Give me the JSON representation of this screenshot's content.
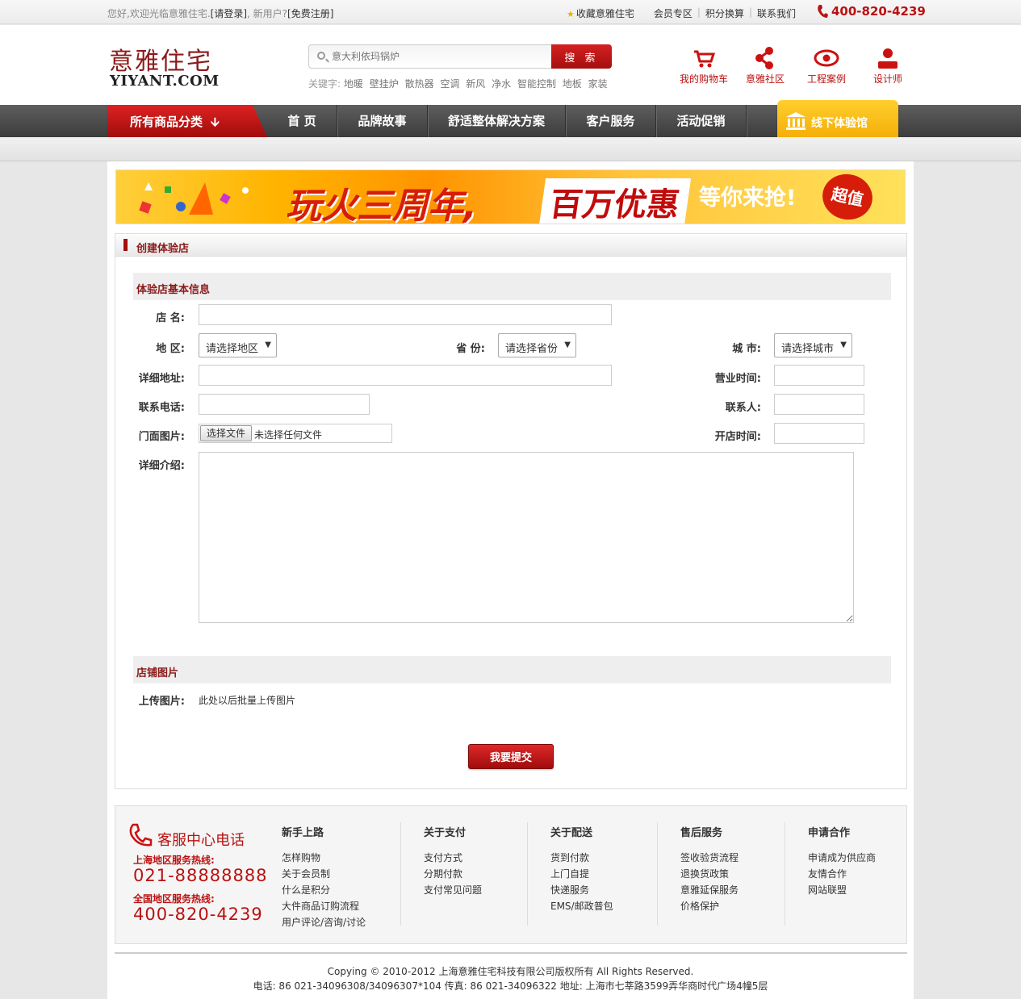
{
  "topbar": {
    "welcome": "您好,欢迎光临意雅住宅.",
    "login": "[请登录]",
    "new_user": ", 新用户?",
    "register": "[免费注册]",
    "bookmark": "收藏意雅住宅",
    "member": "会员专区",
    "points": "积分换算",
    "contact": "联系我们",
    "hotline": "400-820-4239"
  },
  "header": {
    "logo_cn": "意雅住宅",
    "logo_en": "YIYANT.COM",
    "search_placeholder": "意大利依玛锅炉",
    "search_button": "搜 索",
    "keywords_label": "关键字:",
    "keywords": [
      "地暖",
      "壁挂炉",
      "散热器",
      "空调",
      "新风",
      "净水",
      "智能控制",
      "地板",
      "家装"
    ],
    "icons": [
      {
        "label": "我的购物车",
        "icon": "cart-icon"
      },
      {
        "label": "意雅社区",
        "icon": "share-icon"
      },
      {
        "label": "工程案例",
        "icon": "eye-icon"
      },
      {
        "label": "设计师",
        "icon": "user-icon"
      }
    ]
  },
  "nav": {
    "category_button": "所有商品分类",
    "items": [
      {
        "label": "首 页"
      },
      {
        "label": "品牌故事"
      },
      {
        "label": "舒适整体解决方案"
      },
      {
        "label": "客户服务"
      },
      {
        "label": "活动促销"
      }
    ],
    "offline": "线下体验馆"
  },
  "banner": {
    "text1": "玩火三周年,",
    "text2": "百万优惠",
    "text3": "等你来抢!",
    "badge": "超值"
  },
  "form": {
    "panel_title": "创建体验店",
    "section_basic": "体验店基本信息",
    "store_name_label": "店 名:",
    "region_label": "地 区:",
    "region_select": "请选择地区",
    "province_label": "省 份:",
    "province_select": "请选择省份",
    "city_label": "城 市:",
    "city_select": "请选择城市",
    "address_label": "详细地址:",
    "hours_label": "营业时间:",
    "phone_label": "联系电话:",
    "contact_label": "联系人:",
    "photo_label": "门面图片:",
    "file_button": "选择文件",
    "file_text": "未选择任何文件",
    "open_date_label": "开店时间:",
    "intro_label": "详细介绍:",
    "section_photos": "店铺图片",
    "upload_label": "上传图片:",
    "upload_note": "此处以后批量上传图片",
    "submit": "我要提交"
  },
  "footer": {
    "service_title": "客服中心电话",
    "sh_label": "上海地区服务热线:",
    "sh_number": "021-88888888",
    "cn_label": "全国地区服务热线:",
    "cn_number": "400-820-4239",
    "columns": [
      {
        "title": "新手上路",
        "links": [
          "怎样购物",
          "关于会员制",
          "什么是积分",
          "大件商品订购流程",
          "用户评论/咨询/讨论"
        ]
      },
      {
        "title": "关于支付",
        "links": [
          "支付方式",
          "分期付款",
          "支付常见问题"
        ]
      },
      {
        "title": "关于配送",
        "links": [
          "货到付款",
          "上门自提",
          "快递服务",
          "EMS/邮政普包"
        ]
      },
      {
        "title": "售后服务",
        "links": [
          "签收验货流程",
          "退换货政策",
          "意雅延保服务",
          "价格保护"
        ]
      },
      {
        "title": "申请合作",
        "links": [
          "申请成为供应商",
          "友情合作",
          "网站联盟"
        ]
      }
    ],
    "copyright": "Copying © 2010-2012 上海意雅住宅科技有限公司版权所有 All Rights Reserved.",
    "contact_line": "电话: 86 021-34096308/34096307*104 传真: 86 021-34096322 地址: 上海市七莘路3599弄华商时代广场4幢5层"
  },
  "colors": {
    "brand_red": "#a30e0e",
    "accent_yellow": "#f3a800",
    "nav_dark": "#3c3c3c"
  }
}
